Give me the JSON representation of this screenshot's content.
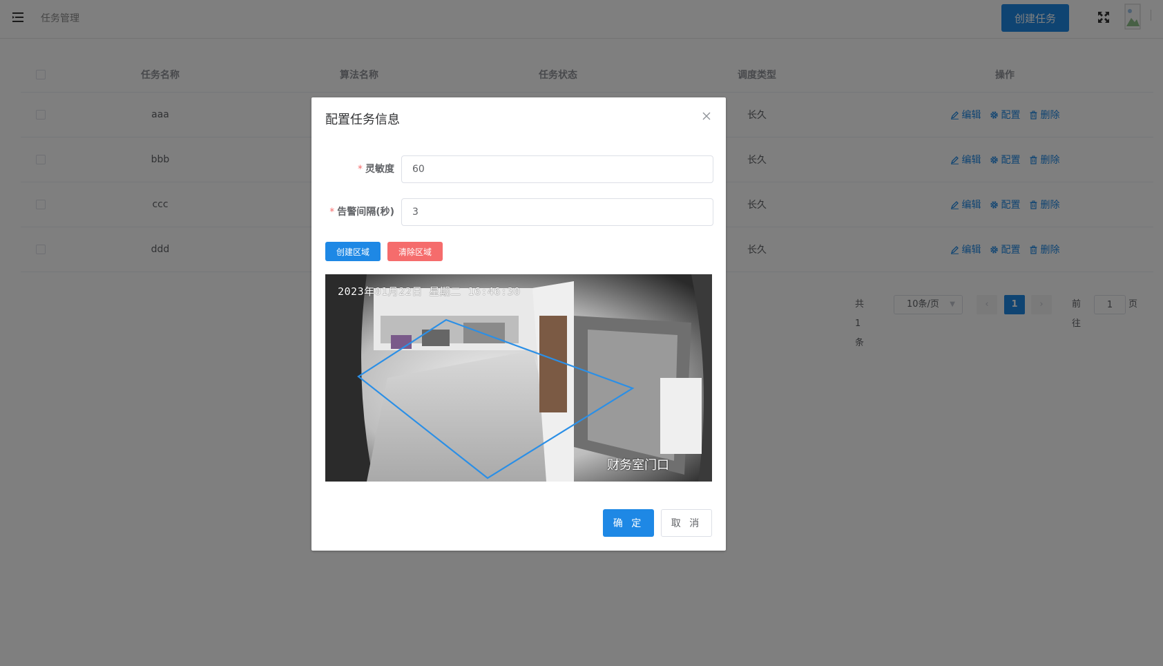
{
  "header": {
    "page_title": "任务管理",
    "create_task_label": "创建任务"
  },
  "table": {
    "columns": [
      "任务名称",
      "算法名称",
      "任务状态",
      "调度类型",
      "操作"
    ],
    "rows": [
      {
        "name": "aaa",
        "algorithm": "",
        "status": "",
        "schedule": "长久"
      },
      {
        "name": "bbb",
        "algorithm": "",
        "status": "",
        "schedule": "长久"
      },
      {
        "name": "ccc",
        "algorithm": "",
        "status": "",
        "schedule": "长久"
      },
      {
        "name": "ddd",
        "algorithm": "",
        "status": "",
        "schedule": "长久"
      }
    ],
    "actions": {
      "edit": "编辑",
      "config": "配置",
      "delete": "删除"
    }
  },
  "pagination": {
    "total_text": "共 1 条",
    "page_size": "10条/页",
    "current_page": "1",
    "goto_label": "前往",
    "goto_value": "1",
    "page_suffix": "页"
  },
  "dialog": {
    "title": "配置任务信息",
    "sensitivity_label": "灵敏度",
    "sensitivity_value": "60",
    "interval_label": "告警间隔(秒)",
    "interval_value": "3",
    "create_area_label": "创建区域",
    "clear_area_label": "清除区域",
    "camera_timestamp": "2023年01月22日 星期二 16:46:30",
    "camera_location": "财务室门口",
    "confirm_label": "确 定",
    "cancel_label": "取 消"
  },
  "colors": {
    "primary": "#1e88e5",
    "danger": "#f56c6c",
    "region_outline": "#2b8fe6"
  },
  "icons": {
    "menu": "menu-fold-icon",
    "fullscreen": "fullscreen-icon",
    "edit": "edit-icon",
    "config": "gear-icon",
    "delete": "trash-icon",
    "close": "close-icon"
  }
}
